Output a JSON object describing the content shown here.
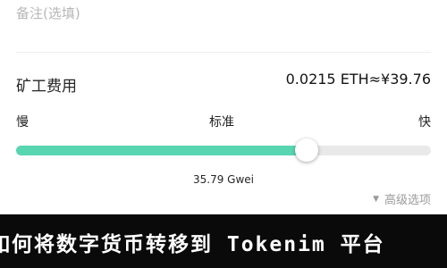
{
  "memo": {
    "label": "备注(选填)"
  },
  "fee": {
    "label": "矿工费用",
    "value": "0.0215 ETH≈¥39.76"
  },
  "speed": {
    "slow_label": "慢",
    "standard_label": "标准",
    "fast_label": "快",
    "slider_level_percent": 70,
    "gas_price": "35.79 Gwei"
  },
  "advanced": {
    "label": "高级选项",
    "icon": "caret-down-icon"
  },
  "banner": {
    "text": "如何将数字货币转移到 Tokenim 平台"
  },
  "colors": {
    "slider_fill": "#58d6b1",
    "slider_track": "#e9e9e9",
    "background_dark": "#0a0a0a"
  }
}
